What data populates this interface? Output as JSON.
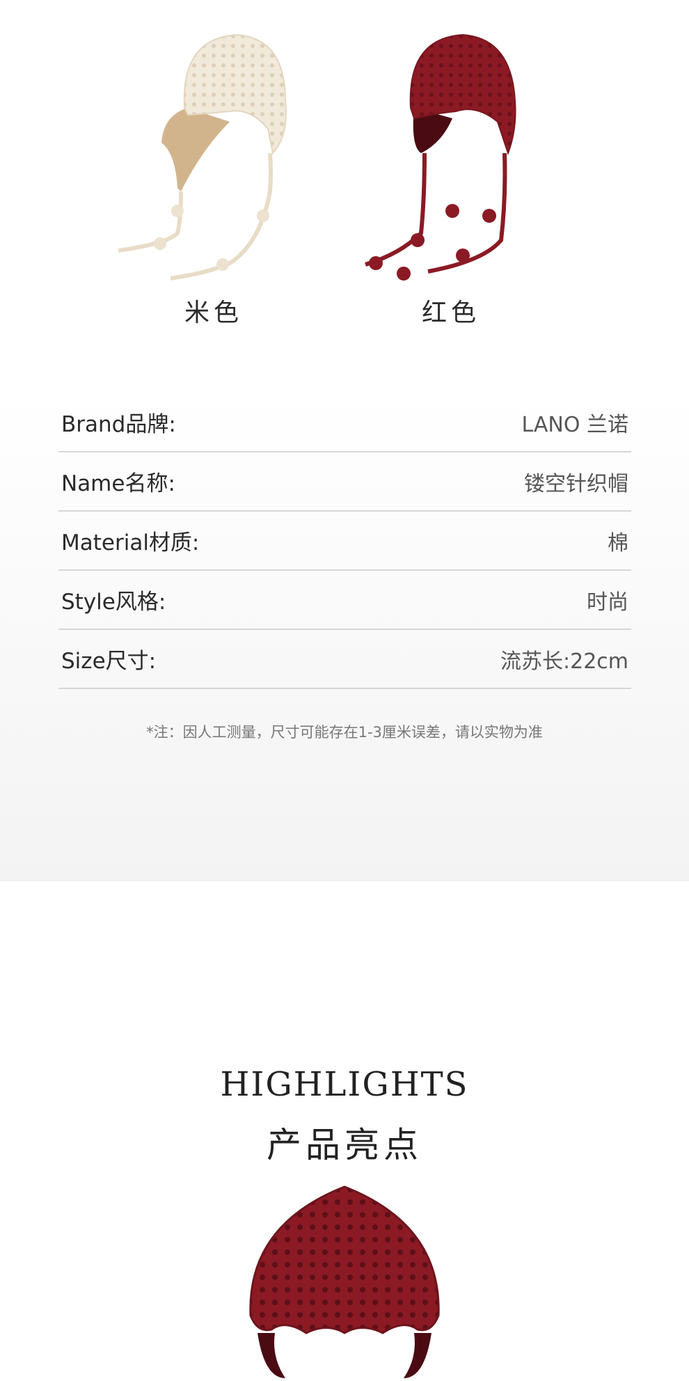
{
  "swatches": [
    {
      "label": "米色",
      "color": "#efe6d6",
      "shade": "#d9c39d"
    },
    {
      "label": "红色",
      "color": "#8b1a24",
      "shade": "#5a0f16"
    }
  ],
  "specs": [
    {
      "label": "Brand品牌:",
      "value": "LANO 兰诺"
    },
    {
      "label": "Name名称:",
      "value": "镂空针织帽"
    },
    {
      "label": "Material材质:",
      "value": "棉"
    },
    {
      "label": "Style风格:",
      "value": "时尚"
    },
    {
      "label": "Size尺寸:",
      "value": "流苏长:22cm"
    }
  ],
  "note": "*注：因人工测量，尺寸可能存在1-3厘米误差，请以实物为准",
  "highlights": {
    "title": "HIGHLIGHTS",
    "subtitle": "产品亮点"
  }
}
